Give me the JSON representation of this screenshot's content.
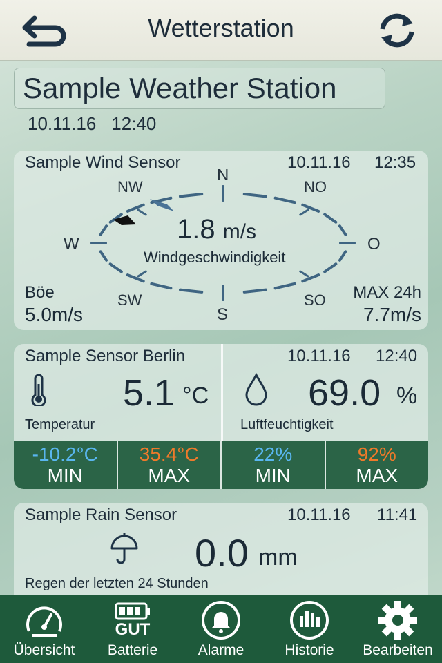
{
  "header": {
    "title": "Wetterstation"
  },
  "station": {
    "name": "Sample Weather Station",
    "date": "10.11.16",
    "time": "12:40"
  },
  "wind": {
    "title": "Sample Wind Sensor",
    "date": "10.11.16",
    "time": "12:35",
    "speed": "1.8",
    "speed_unit": "m/s",
    "speed_label": "Windgeschwindigkeit",
    "gust_label": "Böe",
    "gust_value": "5.0m/s",
    "max_label": "MAX 24h",
    "max_value": "7.7m/s",
    "directions": {
      "n": "N",
      "ne": "NO",
      "e": "O",
      "se": "SO",
      "s": "S",
      "sw": "SW",
      "w": "W",
      "nw": "NW"
    }
  },
  "sensor": {
    "title": "Sample Sensor Berlin",
    "date": "10.11.16",
    "time": "12:40",
    "temperature": "5.1",
    "temperature_unit": "°C",
    "temperature_label": "Temperatur",
    "humidity": "69.0",
    "humidity_unit": "%",
    "humidity_label": "Luftfeuchtigkeit",
    "minmax": [
      {
        "value": "-10.2°C",
        "label": "MIN",
        "color": "#59b6f0"
      },
      {
        "value": "35.4°C",
        "label": "MAX",
        "color": "#f07a2a"
      },
      {
        "value": "22%",
        "label": "MIN",
        "color": "#59b6f0"
      },
      {
        "value": "92%",
        "label": "MAX",
        "color": "#f07a2a"
      }
    ]
  },
  "rain": {
    "title": "Sample Rain Sensor",
    "date": "10.11.16",
    "time": "11:41",
    "value": "0.0",
    "unit": "mm",
    "label": "Regen der letzten 24 Stunden"
  },
  "tabs": [
    {
      "label": "Übersicht",
      "icon": "speedometer-icon"
    },
    {
      "label": "Batterie",
      "icon": "battery-icon",
      "badge": "GUT"
    },
    {
      "label": "Alarme",
      "icon": "bell-icon"
    },
    {
      "label": "Historie",
      "icon": "history-icon"
    },
    {
      "label": "Bearbeiten",
      "icon": "gear-icon"
    }
  ],
  "colors": {
    "tabbar": "#1e5a3b",
    "minmax_bg": "#2b6447",
    "min_text": "#59b6f0",
    "max_text": "#f07a2a",
    "compass": "#3f6582"
  }
}
